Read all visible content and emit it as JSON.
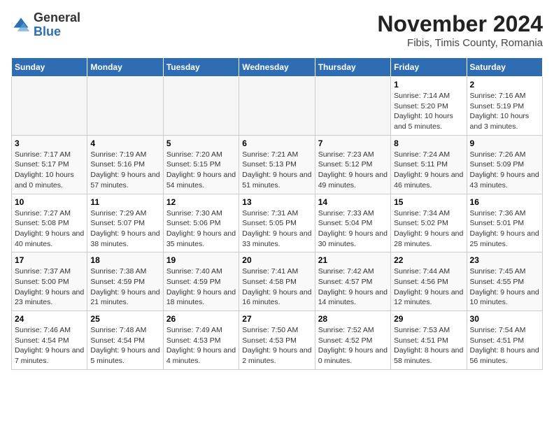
{
  "logo": {
    "general": "General",
    "blue": "Blue"
  },
  "header": {
    "month": "November 2024",
    "location": "Fibis, Timis County, Romania"
  },
  "weekdays": [
    "Sunday",
    "Monday",
    "Tuesday",
    "Wednesday",
    "Thursday",
    "Friday",
    "Saturday"
  ],
  "weeks": [
    [
      {
        "day": "",
        "info": ""
      },
      {
        "day": "",
        "info": ""
      },
      {
        "day": "",
        "info": ""
      },
      {
        "day": "",
        "info": ""
      },
      {
        "day": "",
        "info": ""
      },
      {
        "day": "1",
        "info": "Sunrise: 7:14 AM\nSunset: 5:20 PM\nDaylight: 10 hours and 5 minutes."
      },
      {
        "day": "2",
        "info": "Sunrise: 7:16 AM\nSunset: 5:19 PM\nDaylight: 10 hours and 3 minutes."
      }
    ],
    [
      {
        "day": "3",
        "info": "Sunrise: 7:17 AM\nSunset: 5:17 PM\nDaylight: 10 hours and 0 minutes."
      },
      {
        "day": "4",
        "info": "Sunrise: 7:19 AM\nSunset: 5:16 PM\nDaylight: 9 hours and 57 minutes."
      },
      {
        "day": "5",
        "info": "Sunrise: 7:20 AM\nSunset: 5:15 PM\nDaylight: 9 hours and 54 minutes."
      },
      {
        "day": "6",
        "info": "Sunrise: 7:21 AM\nSunset: 5:13 PM\nDaylight: 9 hours and 51 minutes."
      },
      {
        "day": "7",
        "info": "Sunrise: 7:23 AM\nSunset: 5:12 PM\nDaylight: 9 hours and 49 minutes."
      },
      {
        "day": "8",
        "info": "Sunrise: 7:24 AM\nSunset: 5:11 PM\nDaylight: 9 hours and 46 minutes."
      },
      {
        "day": "9",
        "info": "Sunrise: 7:26 AM\nSunset: 5:09 PM\nDaylight: 9 hours and 43 minutes."
      }
    ],
    [
      {
        "day": "10",
        "info": "Sunrise: 7:27 AM\nSunset: 5:08 PM\nDaylight: 9 hours and 40 minutes."
      },
      {
        "day": "11",
        "info": "Sunrise: 7:29 AM\nSunset: 5:07 PM\nDaylight: 9 hours and 38 minutes."
      },
      {
        "day": "12",
        "info": "Sunrise: 7:30 AM\nSunset: 5:06 PM\nDaylight: 9 hours and 35 minutes."
      },
      {
        "day": "13",
        "info": "Sunrise: 7:31 AM\nSunset: 5:05 PM\nDaylight: 9 hours and 33 minutes."
      },
      {
        "day": "14",
        "info": "Sunrise: 7:33 AM\nSunset: 5:04 PM\nDaylight: 9 hours and 30 minutes."
      },
      {
        "day": "15",
        "info": "Sunrise: 7:34 AM\nSunset: 5:02 PM\nDaylight: 9 hours and 28 minutes."
      },
      {
        "day": "16",
        "info": "Sunrise: 7:36 AM\nSunset: 5:01 PM\nDaylight: 9 hours and 25 minutes."
      }
    ],
    [
      {
        "day": "17",
        "info": "Sunrise: 7:37 AM\nSunset: 5:00 PM\nDaylight: 9 hours and 23 minutes."
      },
      {
        "day": "18",
        "info": "Sunrise: 7:38 AM\nSunset: 4:59 PM\nDaylight: 9 hours and 21 minutes."
      },
      {
        "day": "19",
        "info": "Sunrise: 7:40 AM\nSunset: 4:59 PM\nDaylight: 9 hours and 18 minutes."
      },
      {
        "day": "20",
        "info": "Sunrise: 7:41 AM\nSunset: 4:58 PM\nDaylight: 9 hours and 16 minutes."
      },
      {
        "day": "21",
        "info": "Sunrise: 7:42 AM\nSunset: 4:57 PM\nDaylight: 9 hours and 14 minutes."
      },
      {
        "day": "22",
        "info": "Sunrise: 7:44 AM\nSunset: 4:56 PM\nDaylight: 9 hours and 12 minutes."
      },
      {
        "day": "23",
        "info": "Sunrise: 7:45 AM\nSunset: 4:55 PM\nDaylight: 9 hours and 10 minutes."
      }
    ],
    [
      {
        "day": "24",
        "info": "Sunrise: 7:46 AM\nSunset: 4:54 PM\nDaylight: 9 hours and 7 minutes."
      },
      {
        "day": "25",
        "info": "Sunrise: 7:48 AM\nSunset: 4:54 PM\nDaylight: 9 hours and 5 minutes."
      },
      {
        "day": "26",
        "info": "Sunrise: 7:49 AM\nSunset: 4:53 PM\nDaylight: 9 hours and 4 minutes."
      },
      {
        "day": "27",
        "info": "Sunrise: 7:50 AM\nSunset: 4:53 PM\nDaylight: 9 hours and 2 minutes."
      },
      {
        "day": "28",
        "info": "Sunrise: 7:52 AM\nSunset: 4:52 PM\nDaylight: 9 hours and 0 minutes."
      },
      {
        "day": "29",
        "info": "Sunrise: 7:53 AM\nSunset: 4:51 PM\nDaylight: 8 hours and 58 minutes."
      },
      {
        "day": "30",
        "info": "Sunrise: 7:54 AM\nSunset: 4:51 PM\nDaylight: 8 hours and 56 minutes."
      }
    ]
  ]
}
